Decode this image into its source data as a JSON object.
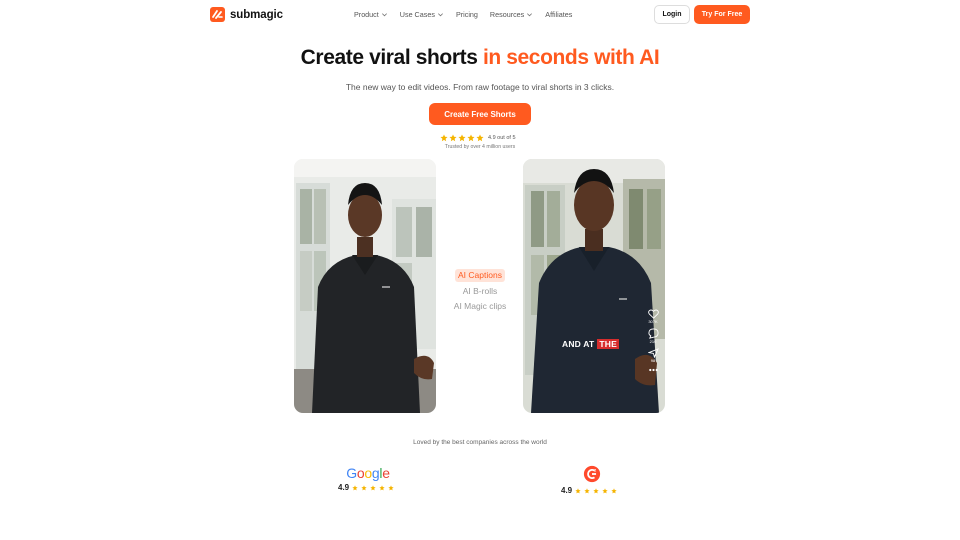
{
  "nav": {
    "logo_text": "submagic",
    "links": [
      {
        "label": "Product",
        "dropdown": true
      },
      {
        "label": "Use Cases",
        "dropdown": true
      },
      {
        "label": "Pricing",
        "dropdown": false
      },
      {
        "label": "Resources",
        "dropdown": true
      },
      {
        "label": "Affiliates",
        "dropdown": false
      }
    ],
    "login_label": "Login",
    "try_label": "Try For Free"
  },
  "hero": {
    "title_main": "Create viral shorts ",
    "title_accent": "in seconds with AI",
    "subtitle": "The new way to edit videos. From raw footage to viral shorts in 3 clicks.",
    "cta_label": "Create Free Shorts",
    "rating_text": "4.9 out of 5",
    "trusted_text": "Trusted by over 4 million users",
    "stars": 5
  },
  "features": [
    "AI Captions",
    "AI B-rolls",
    "AI Magic clips"
  ],
  "active_feature_index": 0,
  "video_right": {
    "caption_words": [
      "AND AT",
      "THE"
    ],
    "likes": "307K",
    "comments": "210",
    "shares": "98"
  },
  "social_proof": {
    "heading": "Loved by the best companies across the world",
    "brands": [
      {
        "name": "Google",
        "score": "4.9"
      },
      {
        "name": "G2",
        "score": "4.9"
      }
    ]
  },
  "colors": {
    "accent": "#ff5a1f",
    "star": "#f5b400"
  }
}
